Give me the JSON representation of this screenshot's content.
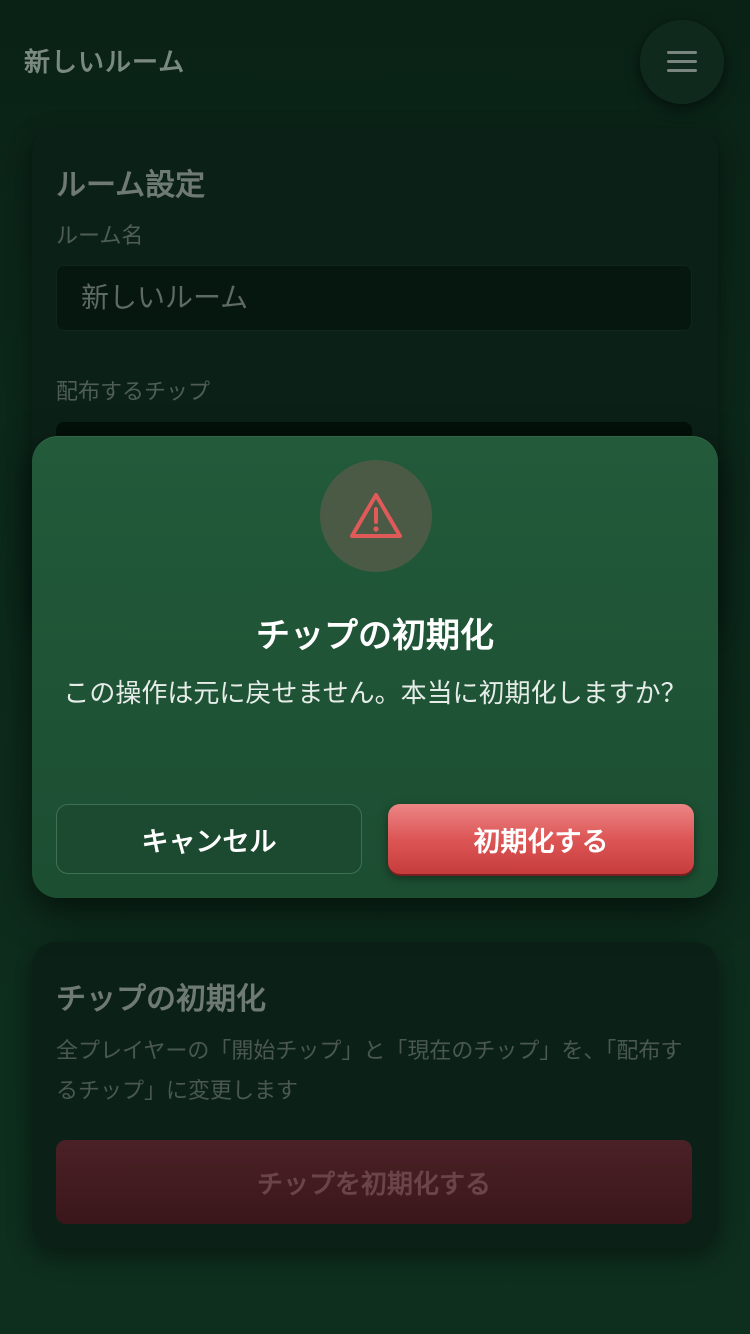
{
  "header": {
    "title": "新しいルーム",
    "menu_icon": "hamburger-menu-icon"
  },
  "room_settings": {
    "title": "ルーム設定",
    "room_name_label": "ルーム名",
    "room_name_value": "新しいルーム",
    "chips_label": "配布するチップ"
  },
  "chip_reset": {
    "title": "チップの初期化",
    "description": "全プレイヤーの「開始チップ」と「現在のチップ」を、「配布するチップ」に変更します",
    "button_label": "チップを初期化する"
  },
  "dialog": {
    "icon": "warning-triangle-icon",
    "title": "チップの初期化",
    "message": "この操作は元に戻せません。本当に初期化しますか？",
    "cancel_label": "キャンセル",
    "confirm_label": "初期化する",
    "accent_color": "#dd5656"
  }
}
